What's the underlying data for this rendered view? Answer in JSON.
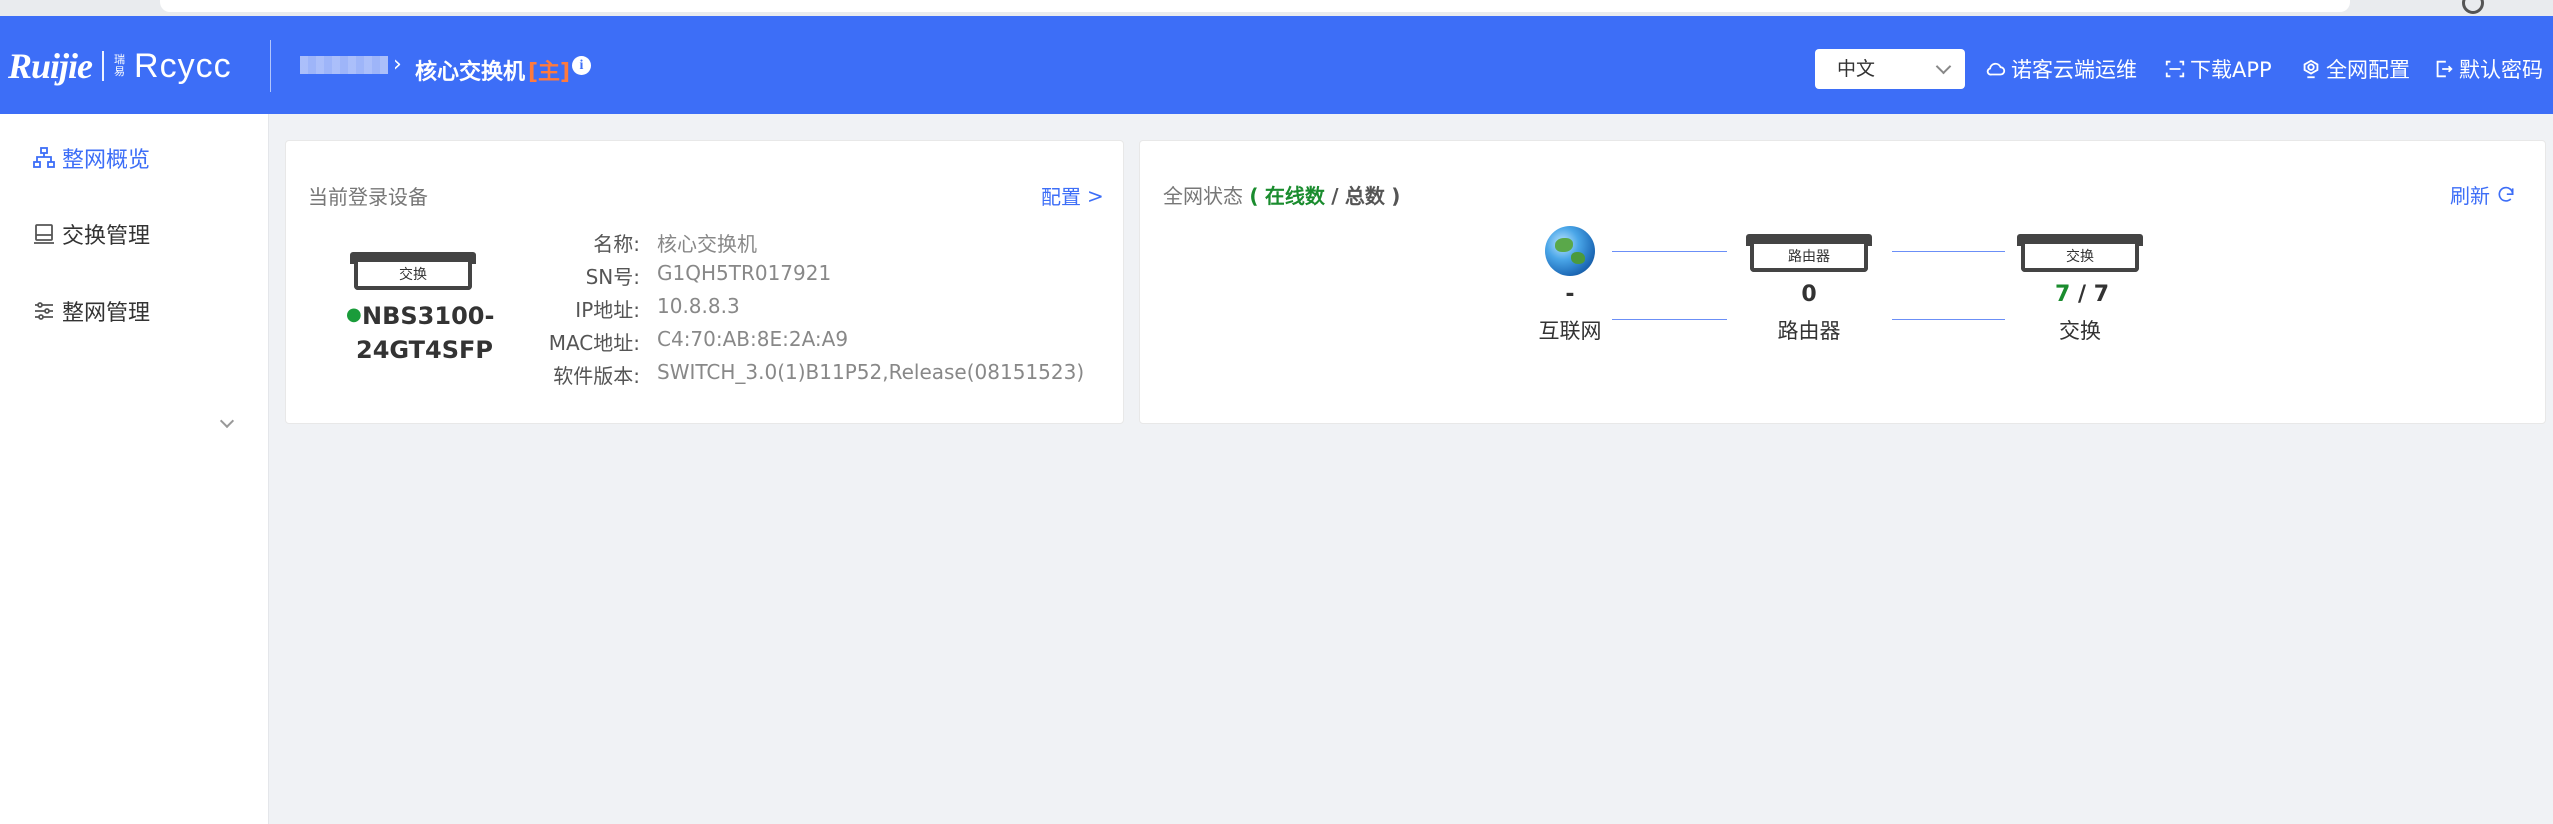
{
  "header": {
    "logo_main": "Ruijie",
    "logo_small": "瑞易",
    "logo_sub": "Rcycc",
    "breadcrumb_device": "核心交换机",
    "breadcrumb_tag": "[主]",
    "info_glyph": "i",
    "language": "中文",
    "links": {
      "cloud": "诺客云端运维",
      "download": "下载APP",
      "network_config": "全网配置",
      "default_password": "默认密码"
    },
    "colors": {
      "bar": "#3d6ef7",
      "tag": "#ff7a3d"
    }
  },
  "sidebar": {
    "items": [
      {
        "label": "整网概览",
        "icon": "topology-icon",
        "active": true
      },
      {
        "label": "交换管理",
        "icon": "switch-device-icon",
        "active": false
      },
      {
        "label": "整网管理",
        "icon": "sliders-icon",
        "active": false
      }
    ]
  },
  "device_card": {
    "title": "当前登录设备",
    "config_link": "配置",
    "config_arrow": ">",
    "device_type_label": "交换",
    "status_dot": "●",
    "model_line1": "NBS3100-",
    "model_line2": "24GT4SFP",
    "fields": [
      {
        "key": "名称:",
        "value": "核心交换机"
      },
      {
        "key": "SN号:",
        "value": "G1QH5TR017921"
      },
      {
        "key": "IP地址:",
        "value": "10.8.8.3"
      },
      {
        "key": "MAC地址:",
        "value": "C4:70:AB:8E:2A:A9"
      },
      {
        "key": "软件版本:",
        "value": "SWITCH_3.0(1)B11P52,Release(08151523)"
      }
    ]
  },
  "network_card": {
    "title_prefix": "全网状态",
    "paren_open": "(",
    "online_label": "在线数",
    "slash": "/",
    "total_label": "总数",
    "paren_close": ")",
    "refresh": "刷新",
    "nodes": {
      "internet": {
        "value": "-",
        "name": "互联网"
      },
      "router": {
        "value": "0",
        "name": "路由器",
        "device_label": "路由器"
      },
      "switch": {
        "online": "7",
        "sep": "/",
        "total": "7",
        "name": "交换",
        "device_label": "交换"
      }
    }
  }
}
